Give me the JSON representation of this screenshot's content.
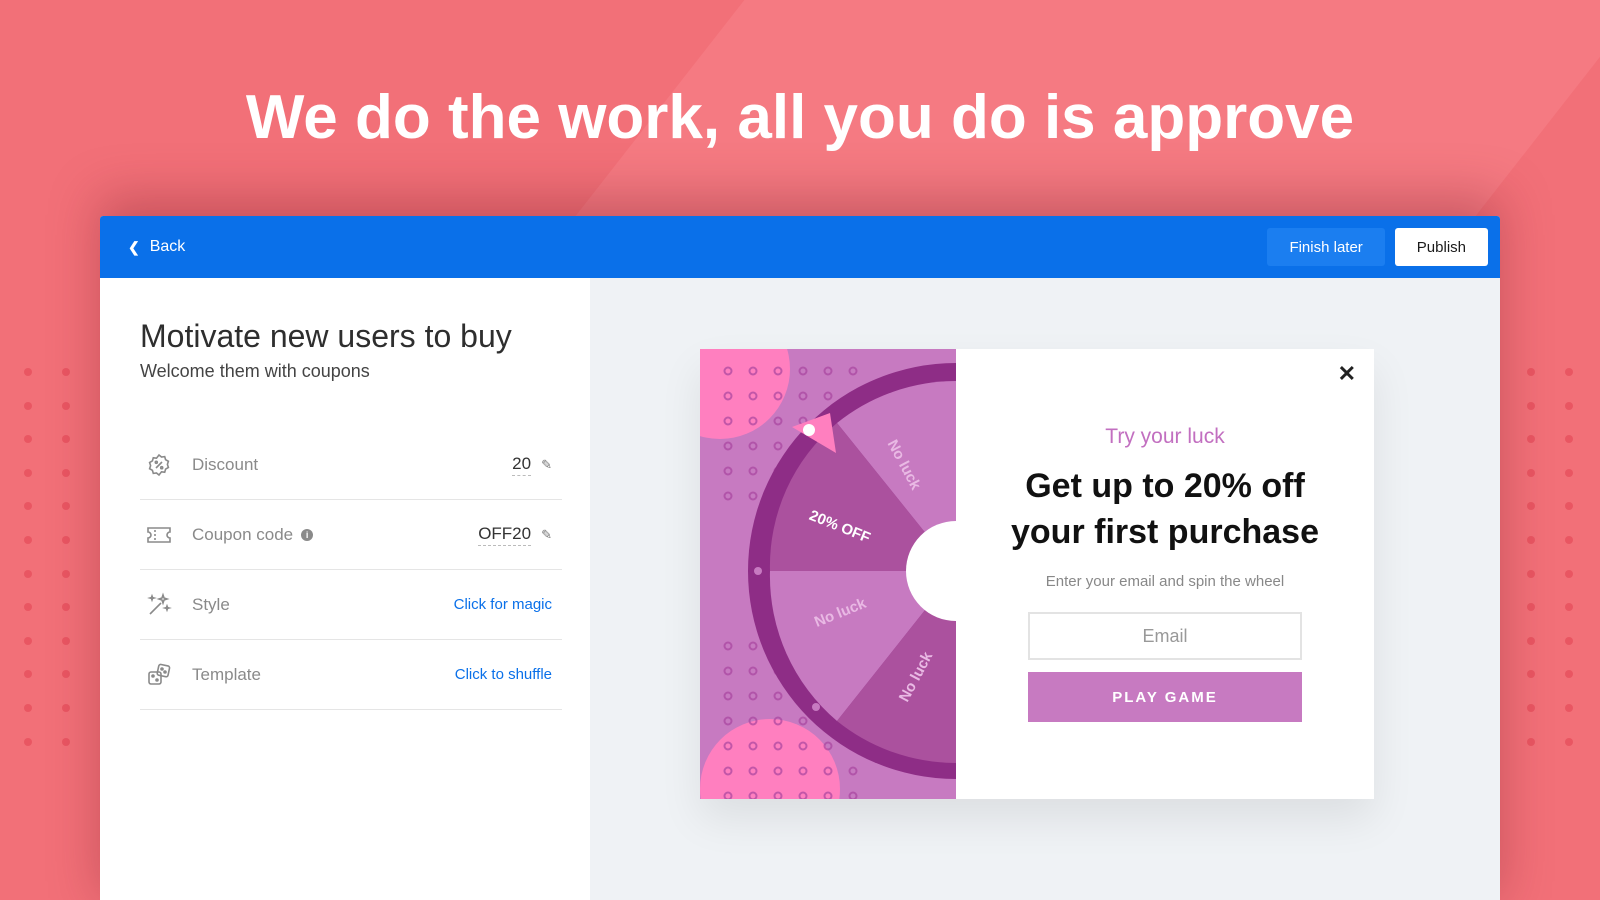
{
  "headline": "We do the work, all you do is approve",
  "topbar": {
    "back_label": "Back",
    "finish_label": "Finish later",
    "publish_label": "Publish"
  },
  "panel": {
    "title": "Motivate new users to buy",
    "subtitle": "Welcome them with coupons",
    "settings": [
      {
        "label": "Discount",
        "value": "20",
        "icon": "percent-badge-icon"
      },
      {
        "label": "Coupon code",
        "value": "OFF20",
        "icon": "ticket-icon"
      },
      {
        "label": "Style",
        "action": "Click for magic",
        "icon": "magic-wand-icon"
      },
      {
        "label": "Template",
        "action": "Click to shuffle",
        "icon": "dice-icon"
      }
    ]
  },
  "popup": {
    "try_text": "Try your luck",
    "offer_line1": "Get up to 20% off",
    "offer_line2": "your first purchase",
    "hint": "Enter your email and spin the wheel",
    "email_placeholder": "Email",
    "play_label": "PLAY GAME",
    "wheel_segments": [
      "No luck",
      "20% OFF",
      "No luck",
      "No luck"
    ]
  },
  "colors": {
    "background": "#f27078",
    "topbar": "#0a70e9",
    "wheel": "#c77ac1",
    "accent_pink": "#ff7fbf"
  }
}
